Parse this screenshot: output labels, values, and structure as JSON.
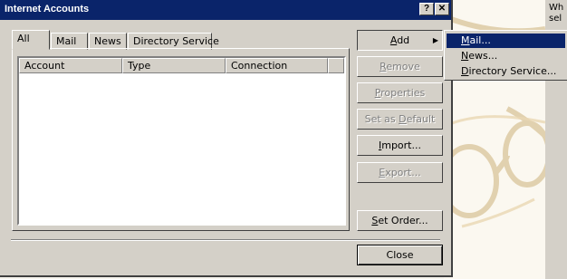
{
  "dialog": {
    "title": "Internet Accounts",
    "help_button": "?",
    "close_button": "✕"
  },
  "tabs": [
    {
      "label": "All",
      "active": true
    },
    {
      "label": "Mail",
      "active": false
    },
    {
      "label": "News",
      "active": false
    },
    {
      "label": "Directory Service",
      "active": false
    }
  ],
  "list": {
    "columns": [
      "Account",
      "Type",
      "Connection"
    ],
    "rows": []
  },
  "buttons": {
    "add": {
      "pre": "",
      "accel": "A",
      "post": "dd",
      "enabled": true
    },
    "remove": {
      "pre": "",
      "accel": "R",
      "post": "emove",
      "enabled": false
    },
    "properties": {
      "pre": "",
      "accel": "P",
      "post": "roperties",
      "enabled": false
    },
    "set_default": {
      "pre": "Set as ",
      "accel": "D",
      "post": "efault",
      "enabled": false
    },
    "import": {
      "pre": "",
      "accel": "I",
      "post": "mport...",
      "enabled": true
    },
    "export": {
      "pre": "",
      "accel": "E",
      "post": "xport...",
      "enabled": false
    },
    "set_order": {
      "pre": "",
      "accel": "S",
      "post": "et Order...",
      "enabled": true
    },
    "close": {
      "label": "Close"
    }
  },
  "add_menu": [
    {
      "accel": "M",
      "rest": "ail...",
      "selected": true
    },
    {
      "accel": "N",
      "rest": "ews...",
      "selected": false
    },
    {
      "accel": "D",
      "rest": "irectory Service...",
      "selected": false
    }
  ],
  "background": {
    "partial_text": "Wh\nsel"
  },
  "colors": {
    "titlebar": "#0a246a",
    "face": "#d4d0c8",
    "highlight": "#0a246a"
  }
}
